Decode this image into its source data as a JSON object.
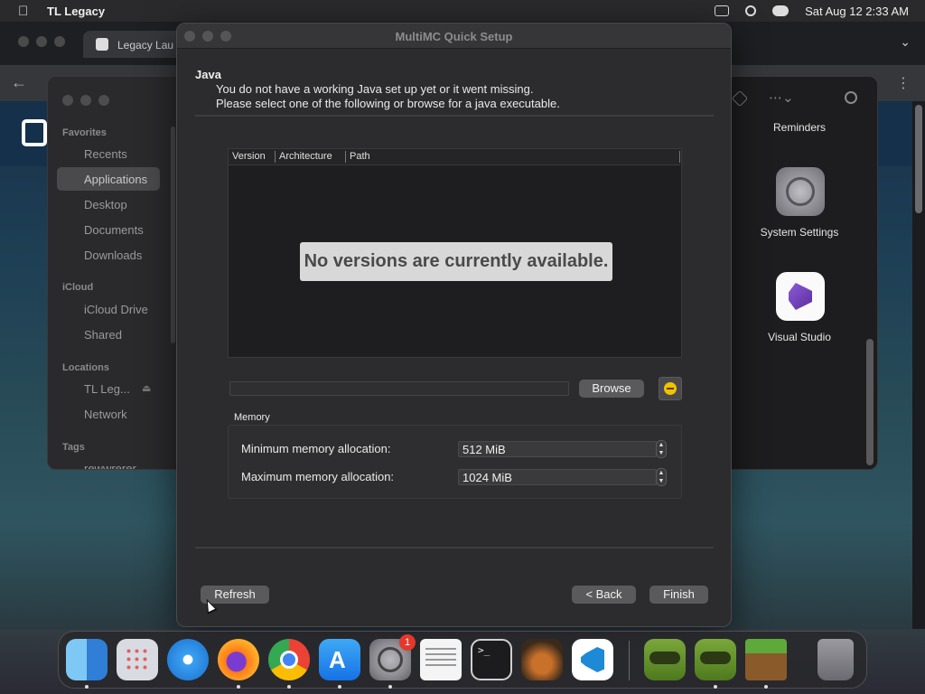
{
  "menubar": {
    "app_name": "TL Legacy",
    "datetime": "Sat Aug 12  2:33 AM"
  },
  "browser": {
    "tab_title": "Legacy Lau"
  },
  "finder": {
    "sections": {
      "favorites": "Favorites",
      "icloud": "iCloud",
      "locations": "Locations",
      "tags": "Tags"
    },
    "items": {
      "recents": "Recents",
      "applications": "Applications",
      "desktop": "Desktop",
      "documents": "Documents",
      "downloads": "Downloads",
      "icloud_drive": "iCloud Drive",
      "shared": "Shared",
      "tl_legacy": "TL Leg...",
      "network": "Network",
      "tag1": "rewwrerer"
    },
    "apps": {
      "reminders": "Reminders",
      "system_settings": "System Settings",
      "visual_studio": "Visual Studio"
    }
  },
  "dialog": {
    "title": "MultiMC Quick Setup",
    "java_heading": "Java",
    "java_line1": "You do not have a working Java set up yet or it went missing.",
    "java_line2": "Please select one of the following or browse for a java executable.",
    "columns": [
      "Version",
      "Architecture",
      "Path"
    ],
    "empty_message": "No versions are currently available.",
    "path_value": "",
    "browse_label": "Browse",
    "memory_label": "Memory",
    "min_mem_label": "Minimum memory allocation:",
    "min_mem_value": "512 MiB",
    "max_mem_label": "Maximum memory allocation:",
    "max_mem_value": "1024 MiB",
    "refresh_label": "Refresh",
    "back_label": "< Back",
    "finish_label": "Finish"
  },
  "dock": {
    "system_settings_badge": "1"
  }
}
